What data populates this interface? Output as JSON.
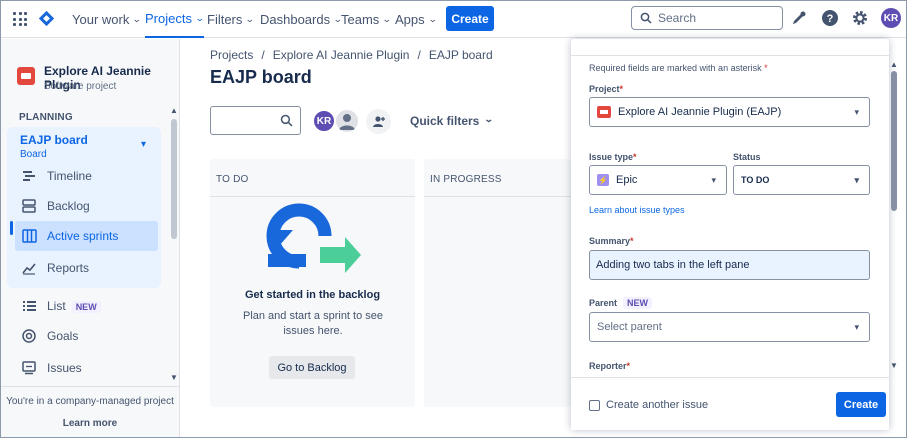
{
  "topnav": {
    "items": [
      "Your work",
      "Projects",
      "Filters",
      "Dashboards",
      "Teams",
      "Apps"
    ],
    "create_label": "Create",
    "search_placeholder": "Search",
    "avatar_initials": "KR",
    "accent": "#0c66e4"
  },
  "sidebar": {
    "project_name": "Explore AI Jeannie Plugin",
    "project_type": "Software project",
    "section": "PLANNING",
    "board_title": "EAJP board",
    "board_subtitle": "Board",
    "board_items": [
      {
        "label": "Timeline",
        "icon": "timeline-icon"
      },
      {
        "label": "Backlog",
        "icon": "backlog-icon"
      },
      {
        "label": "Active sprints",
        "icon": "board-columns-icon",
        "active": true
      },
      {
        "label": "Reports",
        "icon": "chart-line-icon"
      }
    ],
    "items": [
      {
        "label": "List",
        "badge": "NEW",
        "icon": "list-icon"
      },
      {
        "label": "Goals",
        "icon": "goal-icon"
      },
      {
        "label": "Issues",
        "icon": "issues-icon"
      }
    ],
    "footer_text": "You're in a company-managed project",
    "footer_link": "Learn more"
  },
  "main": {
    "breadcrumbs": [
      "Projects",
      "Explore AI Jeannie Plugin",
      "EAJP board"
    ],
    "separator": "/",
    "title": "EAJP board",
    "avatar_initials": "KR",
    "quick_filters_label": "Quick filters",
    "columns": [
      "TO DO",
      "IN PROGRESS"
    ],
    "empty_title": "Get started in the backlog",
    "empty_desc": "Plan and start a sprint to see issues here.",
    "backlog_button": "Go to Backlog"
  },
  "panel": {
    "required_note": "Required fields are marked with an asterisk",
    "project_label": "Project",
    "project_value": "Explore AI Jeannie Plugin (EAJP)",
    "issue_type_label": "Issue type",
    "issue_type_value": "Epic",
    "status_label": "Status",
    "status_value": "TO DO",
    "learn_link": "Learn about issue types",
    "summary_label": "Summary",
    "summary_value": "Adding two tabs in the left pane",
    "parent_label": "Parent",
    "parent_badge": "NEW",
    "parent_placeholder": "Select parent",
    "reporter_label": "Reporter",
    "create_another_label": "Create another issue",
    "create_button": "Create"
  }
}
